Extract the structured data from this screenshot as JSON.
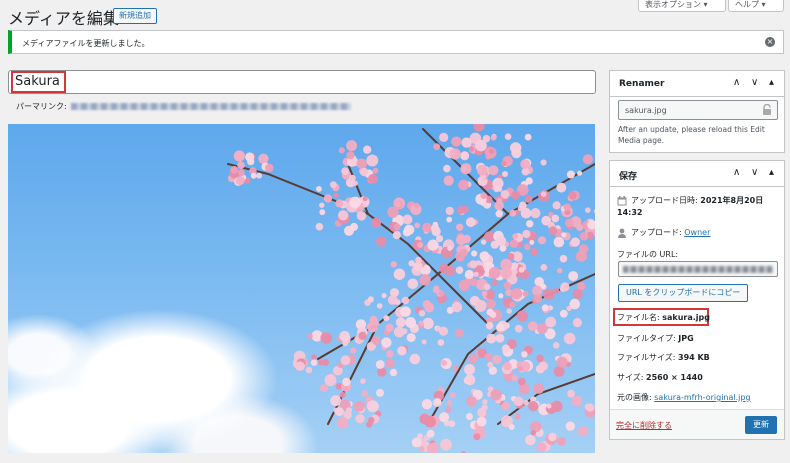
{
  "header": {
    "title": "メディアを編集",
    "add_new_label": "新規追加",
    "screen_options_label": "表示オプション ▾",
    "help_label": "ヘルプ ▾"
  },
  "notice": {
    "message": "メディアファイルを更新しました。",
    "dismiss_icon": "×",
    "accent_color": "#00a32a"
  },
  "editor": {
    "title_value": "Sakura",
    "permalink_label": "パーマリンク:"
  },
  "renamer": {
    "title": "Renamer",
    "filename": "sakura.jpg",
    "note": "After an update, please reload this Edit Media page.",
    "controls": [
      "∧",
      "∨",
      "▴"
    ]
  },
  "save": {
    "title": "保存",
    "controls": [
      "∧",
      "∨",
      "▴"
    ],
    "uploaded_label": "アップロード日時: ",
    "uploaded_value": "2021年8月20日",
    "uploaded_time": "14:32",
    "uploader_label": "アップロード: ",
    "uploader_value": "Owner",
    "file_url_label": "ファイルの URL:",
    "copy_url_label": "URL をクリップボードにコピー",
    "file_name_label": "ファイル名: ",
    "file_name_value": "sakura.jpg",
    "file_type_label": "ファイルタイプ: ",
    "file_type_value": "JPG",
    "file_size_label": "ファイルサイズ: ",
    "file_size_value": "394 KB",
    "dimensions_label": "サイズ: ",
    "dimensions_value": "2560 × 1440",
    "original_label": "元の画像: ",
    "original_value": "sakura-mfrh-original.jpg",
    "delete_label": "完全に削除する",
    "update_label": "更新"
  },
  "colors": {
    "primary": "#2271b1",
    "highlight": "#d63638",
    "delete": "#b32d2e"
  }
}
